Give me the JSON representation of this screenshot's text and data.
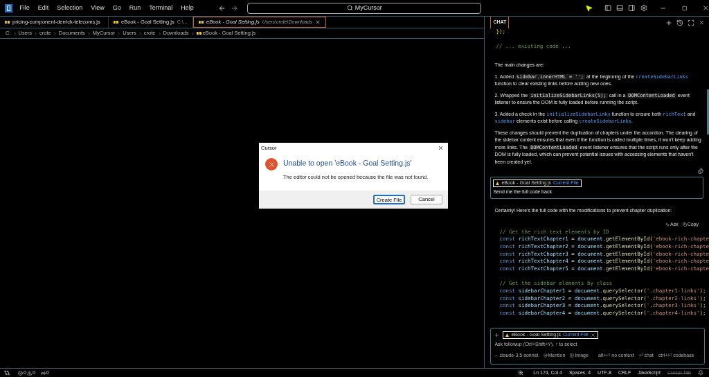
{
  "menu": [
    "File",
    "Edit",
    "Selection",
    "View",
    "Go",
    "Run",
    "Terminal",
    "Help"
  ],
  "search": {
    "value": "MyCursor"
  },
  "tabs": [
    {
      "label": "pricing-component-derrick-telecoms.js",
      "selected": false,
      "preview": false
    },
    {
      "label": "eBook - Goal Setting.js",
      "description": "C:\\...",
      "selected": false,
      "preview": false
    },
    {
      "label": "eBook - Goal Setting.js",
      "description": "Users\\crote\\Downloads",
      "selected": true,
      "preview": true
    }
  ],
  "breadcrumbs": [
    "C:",
    "Users",
    "crote",
    "Documents",
    "MyCursor",
    "Users",
    "crote",
    "Downloads",
    "eBook - Goal Setting.js"
  ],
  "dialog": {
    "title": "Cursor",
    "heading": "Unable to open 'eBook - Goal Setting.js'",
    "message": "The editor could not be opened because the file was not found.",
    "buttons": [
      {
        "label": "Create File",
        "selected": true
      },
      {
        "label": "Cancel",
        "selected": false
      }
    ]
  },
  "chat": {
    "tab": "CHAT",
    "top_code": [
      [
        [
          {
            "kind": "bracket",
            "text": "});"
          }
        ]
      ],
      [
        [
          {
            "kind": "comment",
            "text": "// ... existing code ..."
          }
        ]
      ]
    ],
    "paragraphs": [
      [
        {
          "kind": "text",
          "text": "The main changes are:"
        }
      ],
      [
        {
          "kind": "text",
          "text": "1. Added "
        },
        {
          "kind": "code",
          "text": "sidebar.innerHTML = '';"
        },
        {
          "kind": "text",
          "text": " at the beginning of the "
        },
        {
          "kind": "link",
          "text": "createSidebarLinks"
        },
        {
          "kind": "text",
          "text": " function to clear existing links before adding new ones."
        }
      ],
      [
        {
          "kind": "text",
          "text": "2. Wrapped the "
        },
        {
          "kind": "code",
          "text": "initializeSidebarLinks(5);"
        },
        {
          "kind": "text",
          "text": " call in a "
        },
        {
          "kind": "code",
          "text": "DOMContentLoaded"
        },
        {
          "kind": "text",
          "text": " event listener to ensure the DOM is fully loaded before running the script."
        }
      ],
      [
        {
          "kind": "text",
          "text": "3. Added a check in the "
        },
        {
          "kind": "link",
          "text": "initializeSidebarLinks"
        },
        {
          "kind": "text",
          "text": " function to ensure both "
        },
        {
          "kind": "link",
          "text": "richText"
        },
        {
          "kind": "text",
          "text": " and "
        },
        {
          "kind": "link",
          "text": "sidebar"
        },
        {
          "kind": "text",
          "text": " elements exist before calling "
        },
        {
          "kind": "link",
          "text": "createSidebarLinks"
        },
        {
          "kind": "text",
          "text": "."
        }
      ],
      [
        {
          "kind": "text",
          "text": "These changes should prevent the duplication of chapters under the accordion. The clearing of the sidebar content ensures that even if the function is called multiple times, it won't keep adding more links. The "
        },
        {
          "kind": "code",
          "text": "DOMContentLoaded"
        },
        {
          "kind": "text",
          "text": " event listener ensures that the script runs only after the DOM is fully loaded, which can prevent potential issues with accessing elements that haven't been created yet."
        }
      ]
    ],
    "user_message": {
      "file": "eBook - Goal Setting.js",
      "file_tag": "Current File",
      "text": "Send me the full code back"
    },
    "reply": "Certainly! Here's the full code with the modifications to prevent chapter duplication:",
    "code_actions": [
      "Ask",
      "Copy"
    ],
    "code": [
      [
        [
          {
            "kind": "comment",
            "text": "// Get the rich text elements by ID"
          }
        ],
        [
          {
            "kind": "keyword",
            "text": "const "
          },
          {
            "kind": "variable",
            "text": "richTextChapter1"
          },
          {
            "kind": "punct",
            "text": " = "
          },
          {
            "kind": "variable",
            "text": "document"
          },
          {
            "kind": "punct",
            "text": "."
          },
          {
            "kind": "function",
            "text": "getElementById"
          },
          {
            "kind": "bracket",
            "text": "("
          },
          {
            "kind": "string",
            "text": "'ebook-rich-chapte"
          }
        ],
        [
          {
            "kind": "keyword",
            "text": "const "
          },
          {
            "kind": "variable",
            "text": "richTextChapter2"
          },
          {
            "kind": "punct",
            "text": " = "
          },
          {
            "kind": "variable",
            "text": "document"
          },
          {
            "kind": "punct",
            "text": "."
          },
          {
            "kind": "function",
            "text": "getElementById"
          },
          {
            "kind": "bracket",
            "text": "("
          },
          {
            "kind": "string",
            "text": "'ebook-rich-chapte"
          }
        ],
        [
          {
            "kind": "keyword",
            "text": "const "
          },
          {
            "kind": "variable",
            "text": "richTextChapter3"
          },
          {
            "kind": "punct",
            "text": " = "
          },
          {
            "kind": "variable",
            "text": "document"
          },
          {
            "kind": "punct",
            "text": "."
          },
          {
            "kind": "function",
            "text": "getElementById"
          },
          {
            "kind": "bracket",
            "text": "("
          },
          {
            "kind": "string",
            "text": "'ebook-rich-chapte"
          }
        ],
        [
          {
            "kind": "keyword",
            "text": "const "
          },
          {
            "kind": "variable",
            "text": "richTextChapter4"
          },
          {
            "kind": "punct",
            "text": " = "
          },
          {
            "kind": "variable",
            "text": "document"
          },
          {
            "kind": "punct",
            "text": "."
          },
          {
            "kind": "function",
            "text": "getElementById"
          },
          {
            "kind": "bracket",
            "text": "("
          },
          {
            "kind": "string",
            "text": "'ebook-rich-chapte"
          }
        ],
        [
          {
            "kind": "keyword",
            "text": "const "
          },
          {
            "kind": "variable",
            "text": "richTextChapter5"
          },
          {
            "kind": "punct",
            "text": " = "
          },
          {
            "kind": "variable",
            "text": "document"
          },
          {
            "kind": "punct",
            "text": "."
          },
          {
            "kind": "function",
            "text": "getElementById"
          },
          {
            "kind": "bracket",
            "text": "("
          },
          {
            "kind": "string",
            "text": "'ebook-rich-chapte"
          }
        ]
      ],
      [
        [
          {
            "kind": "comment",
            "text": "// Get the sidebar elements by class"
          }
        ],
        [
          {
            "kind": "keyword",
            "text": "const "
          },
          {
            "kind": "variable",
            "text": "sidebarChapter1"
          },
          {
            "kind": "punct",
            "text": " = "
          },
          {
            "kind": "variable",
            "text": "document"
          },
          {
            "kind": "punct",
            "text": "."
          },
          {
            "kind": "function",
            "text": "querySelector"
          },
          {
            "kind": "bracket",
            "text": "("
          },
          {
            "kind": "string",
            "text": "'.chapter1-links'"
          },
          {
            "kind": "bracket",
            "text": ")"
          },
          {
            "kind": "punct",
            "text": ";"
          }
        ],
        [
          {
            "kind": "keyword",
            "text": "const "
          },
          {
            "kind": "variable",
            "text": "sidebarChapter2"
          },
          {
            "kind": "punct",
            "text": " = "
          },
          {
            "kind": "variable",
            "text": "document"
          },
          {
            "kind": "punct",
            "text": "."
          },
          {
            "kind": "function",
            "text": "querySelector"
          },
          {
            "kind": "bracket",
            "text": "("
          },
          {
            "kind": "string",
            "text": "'.chapter2-links'"
          },
          {
            "kind": "bracket",
            "text": ")"
          },
          {
            "kind": "punct",
            "text": ";"
          }
        ],
        [
          {
            "kind": "keyword",
            "text": "const "
          },
          {
            "kind": "variable",
            "text": "sidebarChapter3"
          },
          {
            "kind": "punct",
            "text": " = "
          },
          {
            "kind": "variable",
            "text": "document"
          },
          {
            "kind": "punct",
            "text": "."
          },
          {
            "kind": "function",
            "text": "querySelector"
          },
          {
            "kind": "bracket",
            "text": "("
          },
          {
            "kind": "string",
            "text": "'.chapter3-links'"
          },
          {
            "kind": "bracket",
            "text": ")"
          },
          {
            "kind": "punct",
            "text": ";"
          }
        ],
        [
          {
            "kind": "keyword",
            "text": "const "
          },
          {
            "kind": "variable",
            "text": "sidebarChapter4"
          },
          {
            "kind": "punct",
            "text": " = "
          },
          {
            "kind": "variable",
            "text": "document"
          },
          {
            "kind": "punct",
            "text": "."
          },
          {
            "kind": "function",
            "text": "querySelector"
          },
          {
            "kind": "bracket",
            "text": "("
          },
          {
            "kind": "string",
            "text": "'.chapter4-links'"
          },
          {
            "kind": "bracket",
            "text": ")"
          },
          {
            "kind": "punct",
            "text": ";"
          }
        ]
      ]
    ],
    "input": {
      "file": "eBook - Goal Setting.js",
      "file_tag": "Current File",
      "placeholder": "Ask followup (Ctrl+Shift+Y), ↑ to select",
      "model": "claude-3.5-sonnet",
      "mention": "Mention",
      "image": "Image",
      "hints": [
        "alt+⏎ no context",
        "⏎ chat",
        "ctrl+⏎ codebase"
      ]
    }
  },
  "status_bar": {
    "errors": "0",
    "warnings": "0",
    "ports": "0",
    "items": [
      {
        "label": "Ln 174, Col 4",
        "disabled": false
      },
      {
        "label": "Spaces: 4",
        "disabled": false
      },
      {
        "label": "UTF-8",
        "disabled": false
      },
      {
        "label": "CRLF",
        "disabled": false
      },
      {
        "label": "JavaScript",
        "disabled": false
      },
      {
        "label": "Cursor Tab",
        "disabled": true
      }
    ]
  }
}
